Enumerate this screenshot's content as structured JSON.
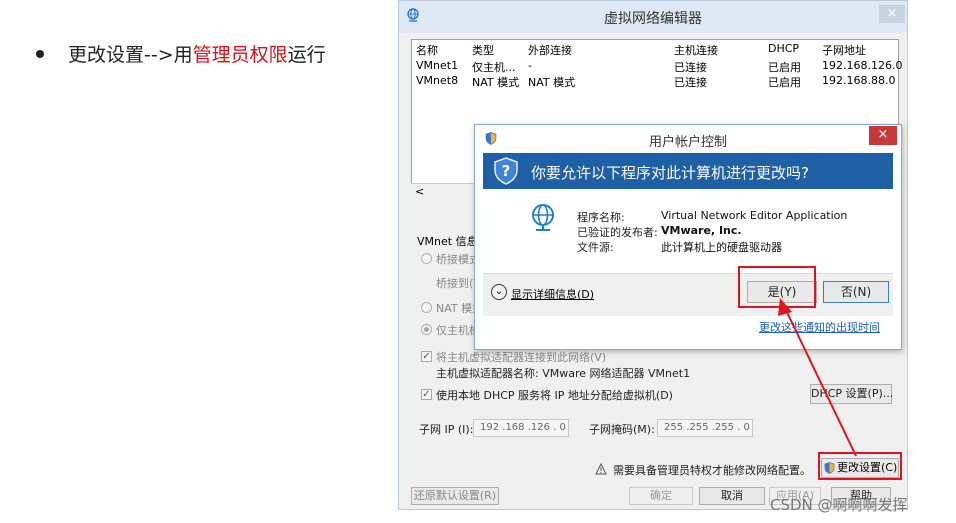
{
  "instruction": {
    "prefix": "更改设置-->用",
    "highlight": "管理员权限",
    "suffix": "运行"
  },
  "vne": {
    "title": "虚拟网络编辑器",
    "close_label": "×",
    "columns": [
      "名称",
      "类型",
      "外部连接",
      "主机连接",
      "DHCP",
      "子网地址"
    ],
    "rows": [
      [
        "VMnet1",
        "仅主机...",
        "-",
        "已连接",
        "已启用",
        "192.168.126.0"
      ],
      [
        "VMnet8",
        "NAT 模式",
        "NAT 模式",
        "已连接",
        "已启用",
        "192.168.88.0"
      ]
    ],
    "scroll_left": "<",
    "vmnet_info_label": "VMnet 信息",
    "bridge_mode": "桥接模式",
    "bridge_to": "桥接到(T)",
    "nat_mode": "NAT 模式",
    "host_only": "仅主机模",
    "connect_adapter": "将主机虚拟适配器连接到此网络(V)",
    "adapter_name": "主机虚拟适配器名称: VMware 网络适配器 VMnet1",
    "use_dhcp": "使用本地 DHCP 服务将 IP 地址分配给虚拟机(D)",
    "dhcp_settings": "DHCP 设置(P)...",
    "subnet_ip_label": "子网 IP (I):",
    "subnet_ip": "192 .168 .126 .  0",
    "subnet_mask_label": "子网掩码(M):",
    "subnet_mask": "255 .255 .255 .  0",
    "admin_notice": "需要具备管理员特权才能修改网络配置。",
    "change_settings": "更改设置(C)",
    "restore_defaults": "还原默认设置(R)",
    "ok": "确定",
    "cancel": "取消",
    "apply": "应用(A)",
    "help": "帮助"
  },
  "uac": {
    "title": "用户帐户控制",
    "close_label": "×",
    "question": "你要允许以下程序对此计算机进行更改吗?",
    "program_name_label": "程序名称:",
    "program_name": "Virtual Network Editor Application",
    "publisher_label": "已验证的发布者:",
    "publisher": "VMware, Inc.",
    "file_source_label": "文件源:",
    "file_source": "此计算机上的硬盘驱动器",
    "show_details": "显示详细信息(D)",
    "yes": "是(Y)",
    "no": "否(N)",
    "change_notify": "更改这些通知的出现时间"
  },
  "watermark": "CSDN @啊啊啊发挥",
  "colors": {
    "highlight_red": "#d0121b",
    "uac_band": "#1f5fa3",
    "annotation_red": "#e0141e"
  }
}
